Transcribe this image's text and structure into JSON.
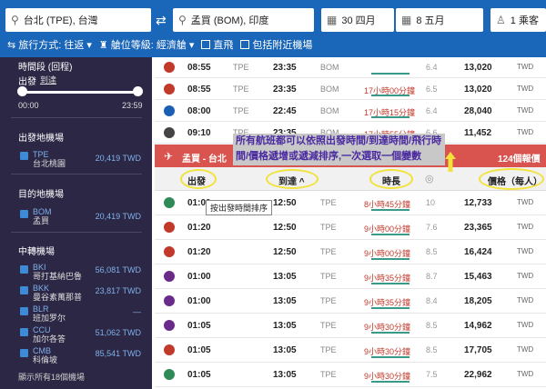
{
  "search": {
    "origin": "台北 (TPE), 台灣",
    "destination": "孟買 (BOM), 印度",
    "depart_date": "30 四月",
    "return_date": "8 五月",
    "passengers": "1 乘客"
  },
  "options": {
    "trip_type": "旅行方式: 往返",
    "cabin_class": "艙位等級: 經濟艙",
    "direct": "直飛",
    "nearby": "包括附近機場"
  },
  "sidebar": {
    "time_title": "時間段 (回程)",
    "tab_depart": "出發",
    "tab_arrive": "到達",
    "time_min": "00:00",
    "time_max": "23:59",
    "dep_airports_title": "出發地機場",
    "dep_airports": [
      {
        "code": "TPE",
        "name": "台北桃園",
        "price": "20,419 TWD"
      }
    ],
    "dest_airports_title": "目的地機場",
    "dest_airports": [
      {
        "code": "BOM",
        "name": "孟買",
        "price": "20,419 TWD"
      }
    ],
    "transit_title": "中轉機場",
    "transit_airports": [
      {
        "code": "BKI",
        "name": "哥打基納巴魯",
        "price": "56,081 TWD"
      },
      {
        "code": "BKK",
        "name": "曼谷素萬那普",
        "price": "23,817 TWD"
      },
      {
        "code": "BLR",
        "name": "班加罗尔",
        "price": "—"
      },
      {
        "code": "CCU",
        "name": "加尔各答",
        "price": "51,062 TWD"
      },
      {
        "code": "CMB",
        "name": "科倫坡",
        "price": "85,541 TWD"
      }
    ],
    "show_all": "顯示所有18個機場"
  },
  "outbound_rows": [
    {
      "dep": "08:55",
      "org": "TPE",
      "arr": "23:35",
      "dst": "BOM",
      "dur": "",
      "stops": "6.4",
      "price": "13,020",
      "cur": "TWD",
      "logo": "#c0392b"
    },
    {
      "dep": "08:55",
      "org": "TPE",
      "arr": "23:35",
      "dst": "BOM",
      "dur": "17小時00分鐘",
      "stops": "6.5",
      "price": "13,020",
      "cur": "TWD",
      "logo": "#c0392b"
    },
    {
      "dep": "08:00",
      "org": "TPE",
      "arr": "22:45",
      "dst": "BOM",
      "dur": "17小時15分鐘",
      "stops": "6.4",
      "price": "28,040",
      "cur": "TWD",
      "logo": "#1a5fb4"
    },
    {
      "dep": "09:10",
      "org": "TPE",
      "arr": "23:35",
      "dst": "BOM",
      "dur": "17小時55分鐘",
      "stops": "6.6",
      "price": "11,452",
      "cur": "TWD",
      "logo": "#444"
    }
  ],
  "route_bar": {
    "label": "孟買 - 台北",
    "count": "124個報價"
  },
  "header": {
    "depart": "出發",
    "arrive": "到達 ^",
    "duration": "時長",
    "price": "價格（每人）"
  },
  "annotation": "所有航班都可以依照出發時間/到達時間/飛行時間/價格遞增或遞減排序,一次選取一個變數",
  "tooltip": "按出發時間排序",
  "return_rows": [
    {
      "dep": "01:00",
      "arr": "12:50",
      "dst": "TPE",
      "dur": "8小時45分鐘",
      "stops": "10",
      "price": "12,733",
      "cur": "TWD",
      "logo": "#2e8b57"
    },
    {
      "dep": "01:20",
      "arr": "12:50",
      "dst": "TPE",
      "dur": "9小時00分鐘",
      "stops": "7.6",
      "price": "23,365",
      "cur": "TWD",
      "logo": "#c0392b"
    },
    {
      "dep": "01:20",
      "arr": "12:50",
      "dst": "TPE",
      "dur": "9小時00分鐘",
      "stops": "8.5",
      "price": "16,424",
      "cur": "TWD",
      "logo": "#c0392b"
    },
    {
      "dep": "01:00",
      "arr": "13:05",
      "dst": "TPE",
      "dur": "9小時35分鐘",
      "stops": "8.7",
      "price": "15,463",
      "cur": "TWD",
      "logo": "#6a2a8a"
    },
    {
      "dep": "01:00",
      "arr": "13:05",
      "dst": "TPE",
      "dur": "9小時35分鐘",
      "stops": "8.4",
      "price": "18,205",
      "cur": "TWD",
      "logo": "#6a2a8a"
    },
    {
      "dep": "01:05",
      "arr": "13:05",
      "dst": "TPE",
      "dur": "9小時30分鐘",
      "stops": "8.5",
      "price": "14,962",
      "cur": "TWD",
      "logo": "#6a2a8a"
    },
    {
      "dep": "01:05",
      "arr": "13:05",
      "dst": "TPE",
      "dur": "9小時30分鐘",
      "stops": "8.5",
      "price": "17,705",
      "cur": "TWD",
      "logo": "#c0392b"
    },
    {
      "dep": "01:05",
      "arr": "13:05",
      "dst": "TPE",
      "dur": "9小時30分鐘",
      "stops": "7.5",
      "price": "22,962",
      "cur": "TWD",
      "logo": "#2e8b57"
    }
  ]
}
